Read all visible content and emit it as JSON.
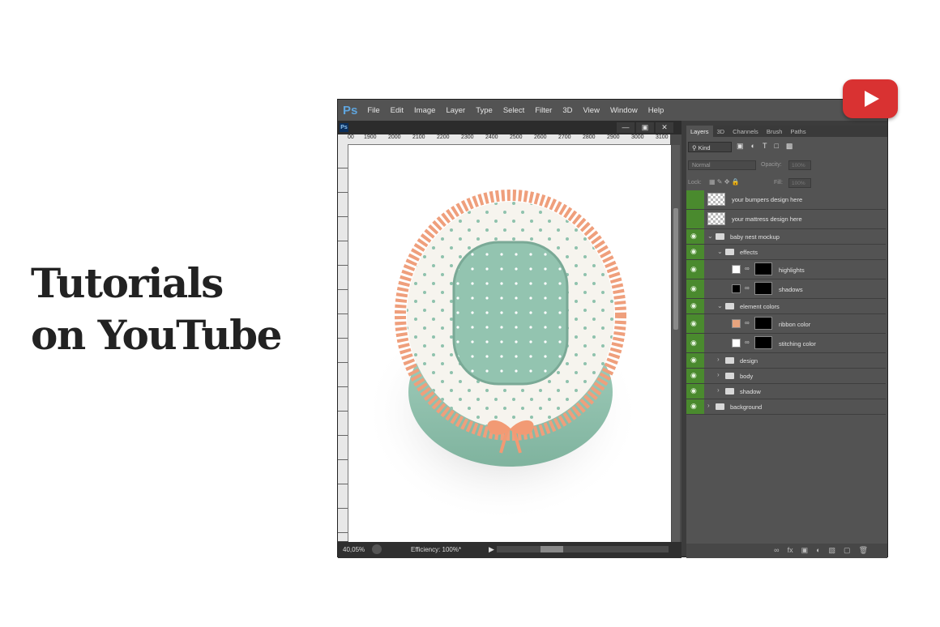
{
  "headline": {
    "line1": "Tutorials",
    "line2": "on YouTube"
  },
  "app": {
    "logo": "Ps",
    "menu": [
      "File",
      "Edit",
      "Image",
      "Layer",
      "Type",
      "Select",
      "Filter",
      "3D",
      "View",
      "Window",
      "Help"
    ]
  },
  "document": {
    "icon": "Ps",
    "window_buttons": [
      "minimize",
      "restore",
      "close"
    ],
    "ruler_h_ticks": [
      "00",
      "1900",
      "2000",
      "2100",
      "2200",
      "2300",
      "2400",
      "2500",
      "2600",
      "2700",
      "2800",
      "2900",
      "3000",
      "3100"
    ],
    "zoom": "40,05%",
    "status": "Efficiency: 100%*"
  },
  "panel": {
    "tabs": [
      "Layers",
      "3D",
      "Channels",
      "Brush",
      "Paths"
    ],
    "filter_kind": "Kind",
    "blend_mode": "Normal",
    "opacity_label": "Opacity:",
    "opacity_value": "100%",
    "lock_label": "Lock:",
    "fill_label": "Fill:",
    "fill_value": "100%",
    "layers": [
      {
        "name": "your bumpers design here",
        "visible": false,
        "type": "smart"
      },
      {
        "name": "your mattress design here",
        "visible": false,
        "type": "smart"
      },
      {
        "name": "baby nest mockup",
        "visible": true,
        "type": "group-open"
      },
      {
        "name": "effects",
        "visible": true,
        "type": "group-open"
      },
      {
        "name": "highlights",
        "visible": true,
        "type": "fill-white"
      },
      {
        "name": "shadows",
        "visible": true,
        "type": "fill-black"
      },
      {
        "name": "element colors",
        "visible": true,
        "type": "group-open"
      },
      {
        "name": "ribbon color",
        "visible": true,
        "type": "fill-peach"
      },
      {
        "name": "stitching color",
        "visible": true,
        "type": "fill-white"
      },
      {
        "name": "design",
        "visible": true,
        "type": "group"
      },
      {
        "name": "body",
        "visible": true,
        "type": "group"
      },
      {
        "name": "shadow",
        "visible": true,
        "type": "group"
      },
      {
        "name": "background",
        "visible": true,
        "type": "group"
      }
    ]
  },
  "colors": {
    "eye_green": "#4a8a2e",
    "ribbon_peach": "#e8a47e",
    "mint": "#8fc2ad",
    "youtube_red": "#d93232"
  }
}
